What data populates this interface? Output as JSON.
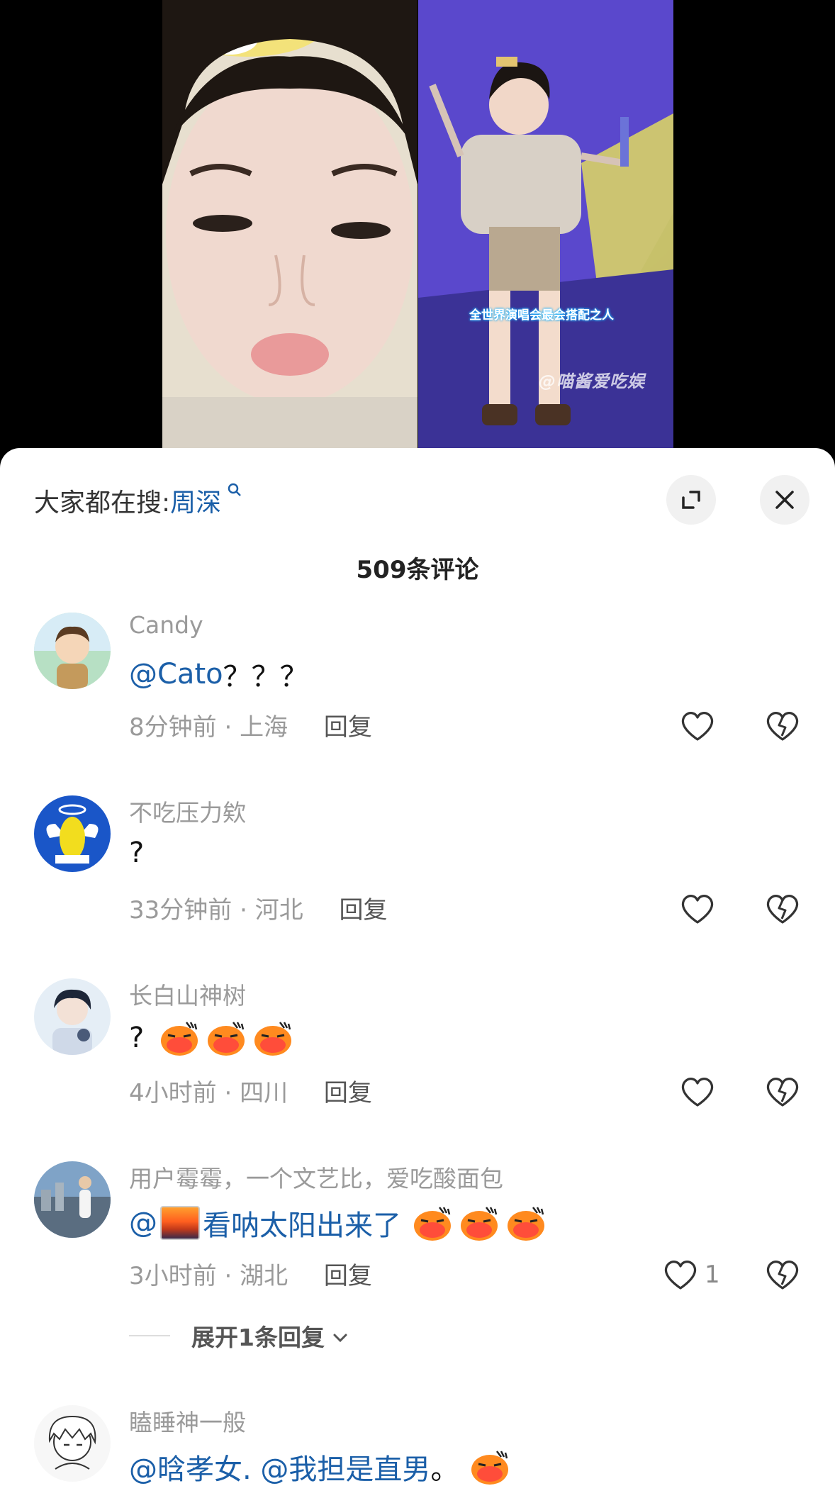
{
  "video": {
    "caption": "全世界演唱会最会搭配之人",
    "watermark": "@喵酱爱吃娱"
  },
  "sheet": {
    "search_label": "大家都在搜:",
    "search_term": "周深",
    "comment_count": "509条评论"
  },
  "comments": [
    {
      "username": "Candy",
      "mention": "@Cato",
      "text": "？？？",
      "time": "8分钟前",
      "location": "上海",
      "reply": "回复"
    },
    {
      "username": "不吃压力欸",
      "text": "?",
      "time": "33分钟前",
      "location": "河北",
      "reply": "回复"
    },
    {
      "username": "长白山神树",
      "text": "?",
      "time": "4小时前",
      "location": "四川",
      "reply": "回复"
    },
    {
      "username": "用户霉霉，一个文艺比，爱吃酸面包",
      "mention": "@",
      "text": "看呐太阳出来了",
      "time": "3小时前",
      "location": "湖北",
      "reply": "回复",
      "likes": "1",
      "expand_replies": "展开1条回复"
    },
    {
      "username": "瞌睡神一般",
      "mention": "@晗孝女. @我担是直男",
      "text": " 。"
    }
  ],
  "icons": {
    "search": "search-icon",
    "expand": "expand-icon",
    "close": "close-icon",
    "like": "heart-icon",
    "dislike": "broken-heart-icon",
    "emoji": "duck-emoji"
  },
  "colors": {
    "mention": "#1b5fa8",
    "muted": "#9a9a9a",
    "sheet_bg": "#ffffff"
  }
}
